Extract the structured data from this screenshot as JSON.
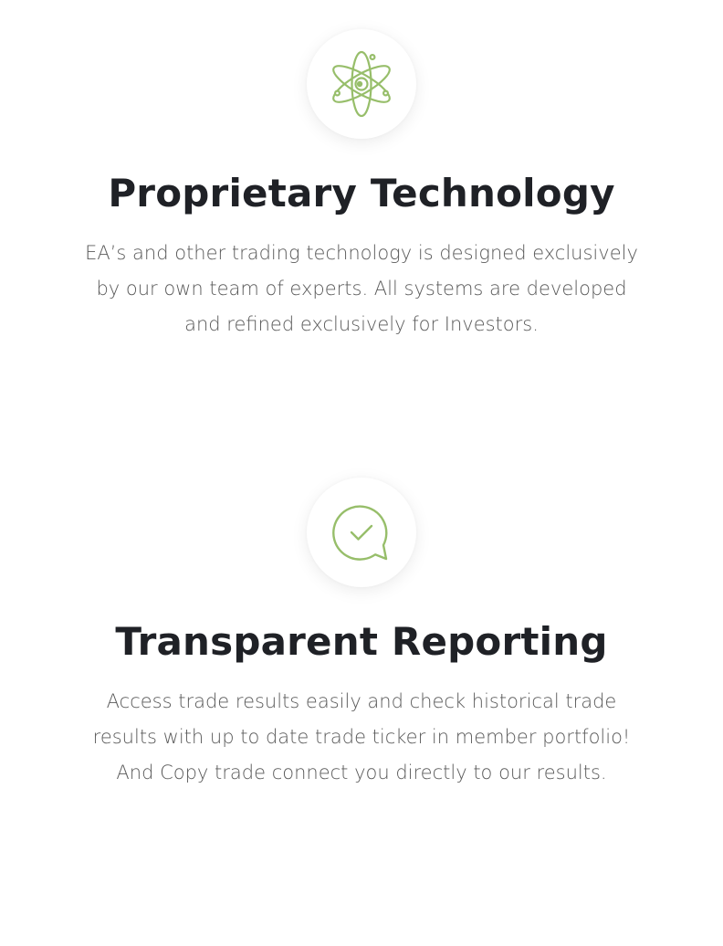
{
  "accent_color": "#97be6a",
  "features": [
    {
      "icon": "atom-icon",
      "title": "Proprietary Technology",
      "description": "EA’s and other trading technology is designed exclusively by our own team of experts. All systems are developed and refined exclusively for Investors."
    },
    {
      "icon": "chat-check-icon",
      "title": "Transparent Reporting",
      "description": "Access trade results easily and check historical trade results with up to date trade ticker in member portfolio! And Copy trade connect you directly to our results."
    }
  ]
}
